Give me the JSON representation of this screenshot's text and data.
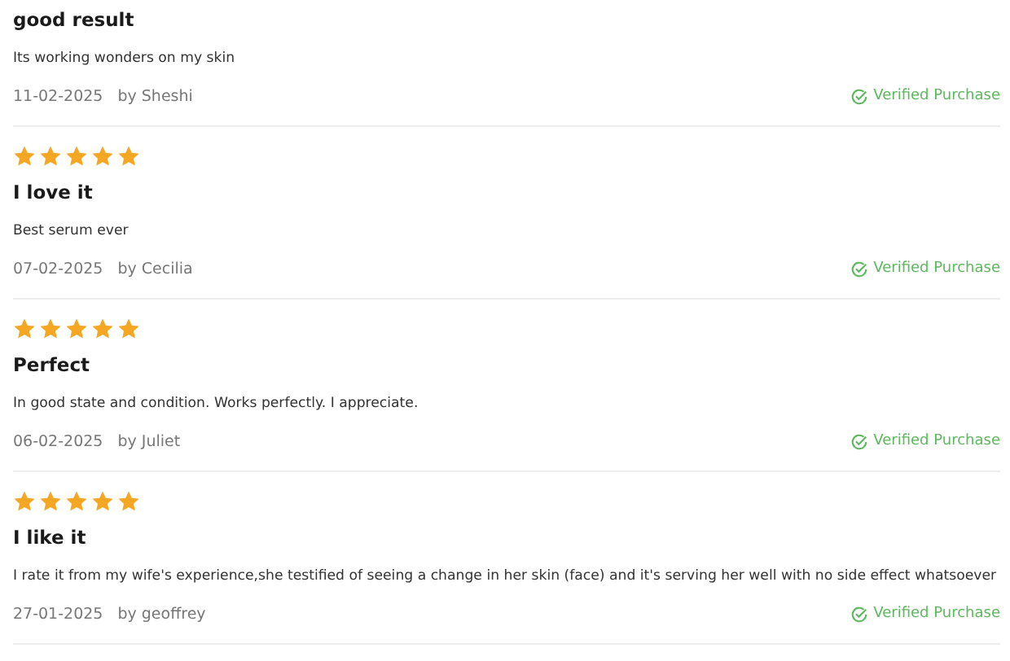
{
  "reviews": [
    {
      "title": "good result",
      "body": "Its working wonders on my skin",
      "date": "11-02-2025",
      "author": "by Sheshi",
      "badge": "Verified Purchase"
    },
    {
      "stars": 5,
      "title": "I love it",
      "body": "Best serum ever",
      "date": "07-02-2025",
      "author": "by Cecilia",
      "badge": "Verified Purchase"
    },
    {
      "stars": 5,
      "title": "Perfect",
      "body": "In good state and condition. Works perfectly. I appreciate.",
      "date": "06-02-2025",
      "author": "by Juliet",
      "badge": "Verified Purchase"
    },
    {
      "stars": 5,
      "title": "I like it",
      "body": "I rate it from my wife's experience,she testified of seeing a change in her skin (face) and it's serving her well with no side effect whatsoever",
      "date": "27-01-2025",
      "author": "by geoffrey",
      "badge": "Verified Purchase"
    }
  ]
}
